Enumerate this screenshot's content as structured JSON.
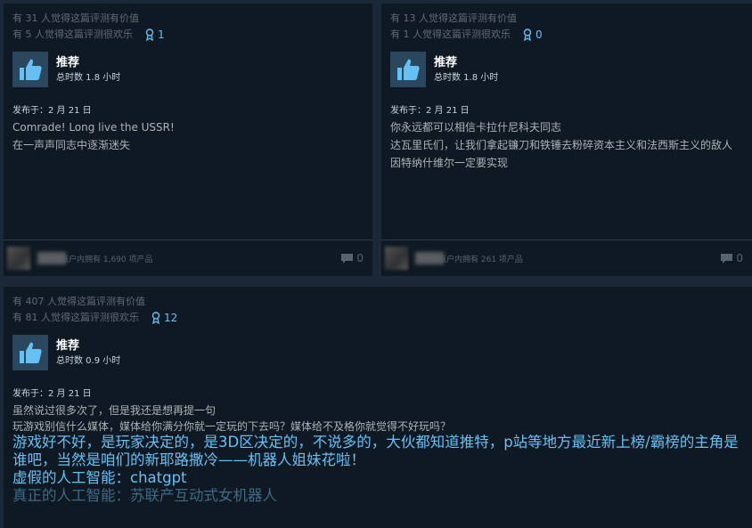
{
  "reviews": [
    {
      "helpful": "有 31 人觉得这篇评测有价值",
      "funny": "有 5 人觉得这篇评测很欢乐",
      "awards": "1",
      "recommend": "推荐",
      "hours": "总时数 1.8 小时",
      "posted": "发布于：2 月 21 日",
      "lines": [
        "Comrade! Long live the USSR!",
        "在一声声同志中逐渐迷失"
      ],
      "products": "账户内拥有 1,690 项产品",
      "comments": "0"
    },
    {
      "helpful": "有 13 人觉得这篇评测有价值",
      "funny": "有 1 人觉得这篇评测很欢乐",
      "awards": "0",
      "recommend": "推荐",
      "hours": "总时数 1.8 小时",
      "posted": "发布于：2 月 21 日",
      "lines": [
        "你永远都可以相信卡拉什尼科夫同志",
        "达瓦里氏们，让我们拿起镰刀和铁锤去粉碎资本主义和法西斯主义的敌人",
        "因特纳什维尔一定要实现"
      ],
      "products": "账户内拥有 261 项产品",
      "comments": "0"
    },
    {
      "helpful": "有 407 人觉得这篇评测有价值",
      "funny": "有 81 人觉得这篇评测很欢乐",
      "awards": "12",
      "recommend": "推荐",
      "hours": "总时数 0.9 小时",
      "posted": "发布于：2 月 21 日",
      "lines": [
        "虽然说过很多次了，但是我还是想再提一句",
        "玩游戏别信什么媒体，媒体给你满分你就一定玩的下去吗？媒体给不及格你就觉得不好玩吗？"
      ],
      "big_lines": [
        "游戏好不好，是玩家决定的，是3D区决定的，不说多的，大伙都知道推特，p站等地方最近新上榜/霸榜的主角是谁吧，当然是咱们的新耶路撒冷——机器人姐妹花啦！",
        "虚假的人工智能：chatgpt",
        "真正的人工智能：苏联产互动式女机器人"
      ]
    }
  ],
  "colors": {
    "background": "#1b2838",
    "card": "#0f1923",
    "accent": "#66c0f4",
    "thumb_bg": "#2a475e"
  },
  "icons": {
    "award": "award-ribbon-icon",
    "recommend": "thumbs-up-icon",
    "comment": "comment-bubble-icon"
  }
}
